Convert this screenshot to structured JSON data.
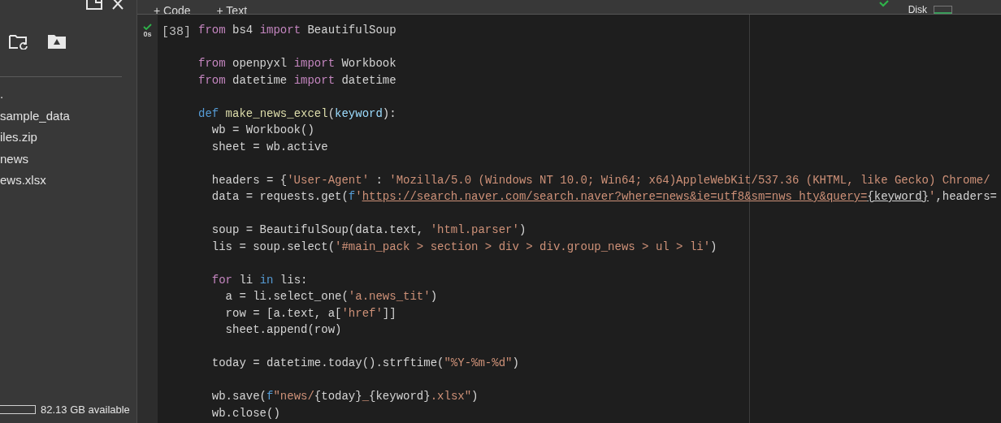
{
  "sidebar": {
    "files": [
      {
        "name": "."
      },
      {
        "name": "sample_data"
      },
      {
        "name": "iles.zip"
      },
      {
        "name": "news"
      },
      {
        "name": "ews.xlsx"
      }
    ],
    "disk": {
      "text": "82.13 GB available"
    }
  },
  "toolbar": {
    "buttons": [
      "+ Code",
      "+ Text"
    ],
    "resources": {
      "label": "Disk"
    }
  },
  "cell": {
    "execution_count": "[38]",
    "run_time": "0s",
    "ran_ok": true,
    "lines": [
      {
        "kind": "code",
        "tokens": [
          {
            "t": "from",
            "kind": "kw"
          },
          {
            "t": " bs4 ",
            "kind": "plain"
          },
          {
            "t": "import",
            "kind": "kw"
          },
          {
            "t": " BeautifulSoup",
            "kind": "plain"
          }
        ]
      },
      {
        "kind": "blank"
      },
      {
        "kind": "code",
        "tokens": [
          {
            "t": "from",
            "kind": "kw"
          },
          {
            "t": " openpyxl ",
            "kind": "plain"
          },
          {
            "t": "import",
            "kind": "kw"
          },
          {
            "t": " Workbook",
            "kind": "plain"
          }
        ]
      },
      {
        "kind": "code",
        "tokens": [
          {
            "t": "from",
            "kind": "kw"
          },
          {
            "t": " datetime ",
            "kind": "plain"
          },
          {
            "t": "import",
            "kind": "kw"
          },
          {
            "t": " datetime",
            "kind": "plain"
          }
        ]
      },
      {
        "kind": "blank"
      },
      {
        "kind": "code",
        "tokens": [
          {
            "t": "def",
            "kind": "def"
          },
          {
            "t": " make_news_excel",
            "kind": "fn"
          },
          {
            "t": "(",
            "kind": "plain"
          },
          {
            "t": "keyword",
            "kind": "param"
          },
          {
            "t": "):",
            "kind": "plain"
          }
        ]
      },
      {
        "kind": "code",
        "tokens": [
          {
            "t": "  wb = Workbook()",
            "kind": "plain"
          }
        ]
      },
      {
        "kind": "code",
        "tokens": [
          {
            "t": "  sheet = wb.active",
            "kind": "plain"
          }
        ]
      },
      {
        "kind": "blank"
      },
      {
        "kind": "code",
        "tokens": [
          {
            "t": "  headers = {",
            "kind": "plain"
          },
          {
            "t": "'User-Agent'",
            "kind": "str"
          },
          {
            "t": " : ",
            "kind": "plain"
          },
          {
            "t": "'Mozilla/5.0 (Windows NT 10.0; Win64; x64)AppleWebKit/537.36 (KHTML, like Gecko) Chrome/",
            "kind": "str"
          }
        ]
      },
      {
        "kind": "code",
        "tokens": [
          {
            "t": "  data = requests.get(",
            "kind": "plain"
          },
          {
            "t": "f",
            "kind": "def"
          },
          {
            "t": "'",
            "kind": "str"
          },
          {
            "t": "https://search.naver.com/search.naver?where=news&ie=utf8&sm=nws_hty&query=",
            "kind": "link"
          },
          {
            "t": "{keyword}",
            "kind": "linkvar"
          },
          {
            "t": "'",
            "kind": "str"
          },
          {
            "t": ",headers=",
            "kind": "plain"
          }
        ]
      },
      {
        "kind": "blank"
      },
      {
        "kind": "code",
        "tokens": [
          {
            "t": "  soup = BeautifulSoup(data.text, ",
            "kind": "plain"
          },
          {
            "t": "'html.parser'",
            "kind": "str"
          },
          {
            "t": ")",
            "kind": "plain"
          }
        ]
      },
      {
        "kind": "code",
        "tokens": [
          {
            "t": "  lis = soup.select(",
            "kind": "plain"
          },
          {
            "t": "'#main_pack > section > div > div.group_news > ul > li'",
            "kind": "str"
          },
          {
            "t": ")",
            "kind": "plain"
          }
        ]
      },
      {
        "kind": "blank"
      },
      {
        "kind": "code",
        "tokens": [
          {
            "t": "  for",
            "kind": "kw"
          },
          {
            "t": " li ",
            "kind": "plain"
          },
          {
            "t": "in",
            "kind": "def"
          },
          {
            "t": " lis:",
            "kind": "plain"
          }
        ]
      },
      {
        "kind": "code",
        "tokens": [
          {
            "t": "    a = li.select_one(",
            "kind": "plain"
          },
          {
            "t": "'a.news_tit'",
            "kind": "str"
          },
          {
            "t": ")",
            "kind": "plain"
          }
        ]
      },
      {
        "kind": "code",
        "tokens": [
          {
            "t": "    row = [a.text, a[",
            "kind": "plain"
          },
          {
            "t": "'href'",
            "kind": "str"
          },
          {
            "t": "]]",
            "kind": "plain"
          }
        ]
      },
      {
        "kind": "code",
        "tokens": [
          {
            "t": "    sheet.append(row)",
            "kind": "plain"
          }
        ]
      },
      {
        "kind": "blank"
      },
      {
        "kind": "code",
        "tokens": [
          {
            "t": "  today = datetime.today().strftime(",
            "kind": "plain"
          },
          {
            "t": "\"%Y-%m-%d\"",
            "kind": "str"
          },
          {
            "t": ")",
            "kind": "plain"
          }
        ]
      },
      {
        "kind": "blank"
      },
      {
        "kind": "code",
        "tokens": [
          {
            "t": "  wb.save(",
            "kind": "plain"
          },
          {
            "t": "f",
            "kind": "def"
          },
          {
            "t": "\"news/",
            "kind": "str"
          },
          {
            "t": "{today}",
            "kind": "plain"
          },
          {
            "t": "_",
            "kind": "str"
          },
          {
            "t": "{keyword}",
            "kind": "plain"
          },
          {
            "t": ".xlsx\"",
            "kind": "str"
          },
          {
            "t": ")",
            "kind": "plain"
          }
        ]
      },
      {
        "kind": "code",
        "tokens": [
          {
            "t": "  wb.close()",
            "kind": "plain"
          }
        ]
      }
    ]
  }
}
